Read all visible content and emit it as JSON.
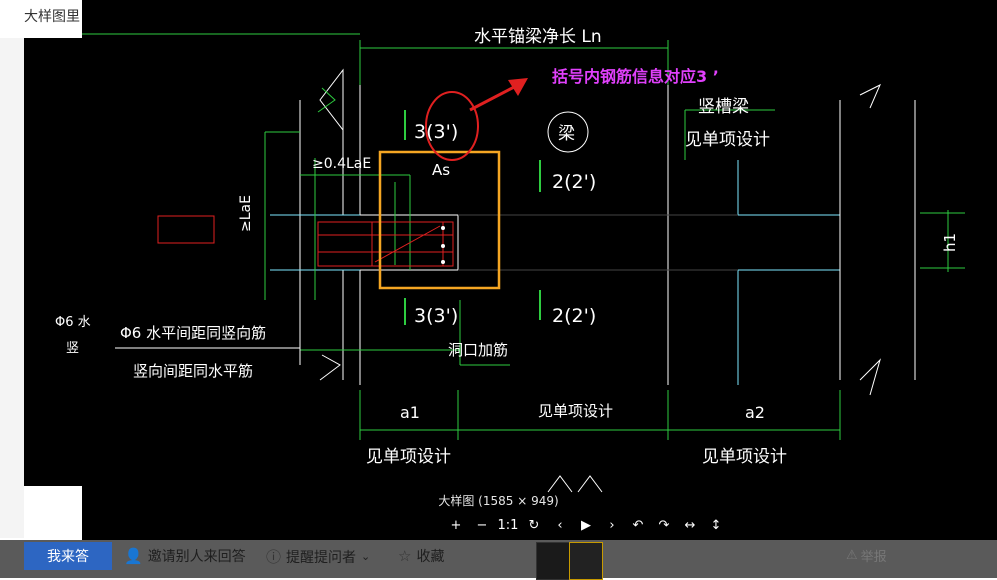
{
  "page": {
    "title": "大样图里"
  },
  "viewer": {
    "caption": "大样图 (1585 × 949)"
  },
  "annotation": {
    "text": "括号内钢筋信息对应3 ’",
    "color": "#e040fb"
  },
  "drawing": {
    "top_label": "水平锚梁净长 Ln",
    "vertical_beam": "竖槽梁",
    "see_design_1": "见单项设计",
    "liang": "梁",
    "label_3_top": "3(3')",
    "label_2_top": "2(2')",
    "label_3_bottom": "3(3')",
    "label_2_bottom": "2(2')",
    "as": "As",
    "anchor_04": "≥0.4LaE",
    "anchor_lae": "≥LaE",
    "note_phi6": "Φ6 水平间距同竖向筋",
    "note_vertical": "竖向间距同水平筋",
    "hole_rebar": "洞口加筋",
    "h1": "h1",
    "a1": "a1",
    "a2": "a2",
    "see_design_mid": "见单项设计",
    "see_design_bottom_left": "见单项设计",
    "see_design_bottom_right": "见单项设计",
    "left_cut_1": "Φ6 水",
    "left_cut_2": "竖"
  },
  "toolbar": [
    {
      "name": "zoom-in-button",
      "glyph": "+"
    },
    {
      "name": "zoom-out-button",
      "glyph": "−"
    },
    {
      "name": "actual-size-button",
      "glyph": "1:1"
    },
    {
      "name": "reset-button",
      "glyph": "↻"
    },
    {
      "name": "prev-button",
      "glyph": "‹"
    },
    {
      "name": "play-button",
      "glyph": "▶"
    },
    {
      "name": "next-button",
      "glyph": "›"
    },
    {
      "name": "rotate-left-button",
      "glyph": "↶"
    },
    {
      "name": "rotate-right-button",
      "glyph": "↷"
    },
    {
      "name": "flip-horizontal-button",
      "glyph": "↔"
    },
    {
      "name": "flip-vertical-button",
      "glyph": "↕"
    }
  ],
  "bottom": {
    "answer": "我来答",
    "invite": "邀请别人来回答",
    "remind": "提醒提问者",
    "collect": "收藏",
    "report": "举报"
  },
  "icons": {
    "invite": "person-icon",
    "remind": "info-icon",
    "collect": "star-icon",
    "report": "warning-icon"
  }
}
